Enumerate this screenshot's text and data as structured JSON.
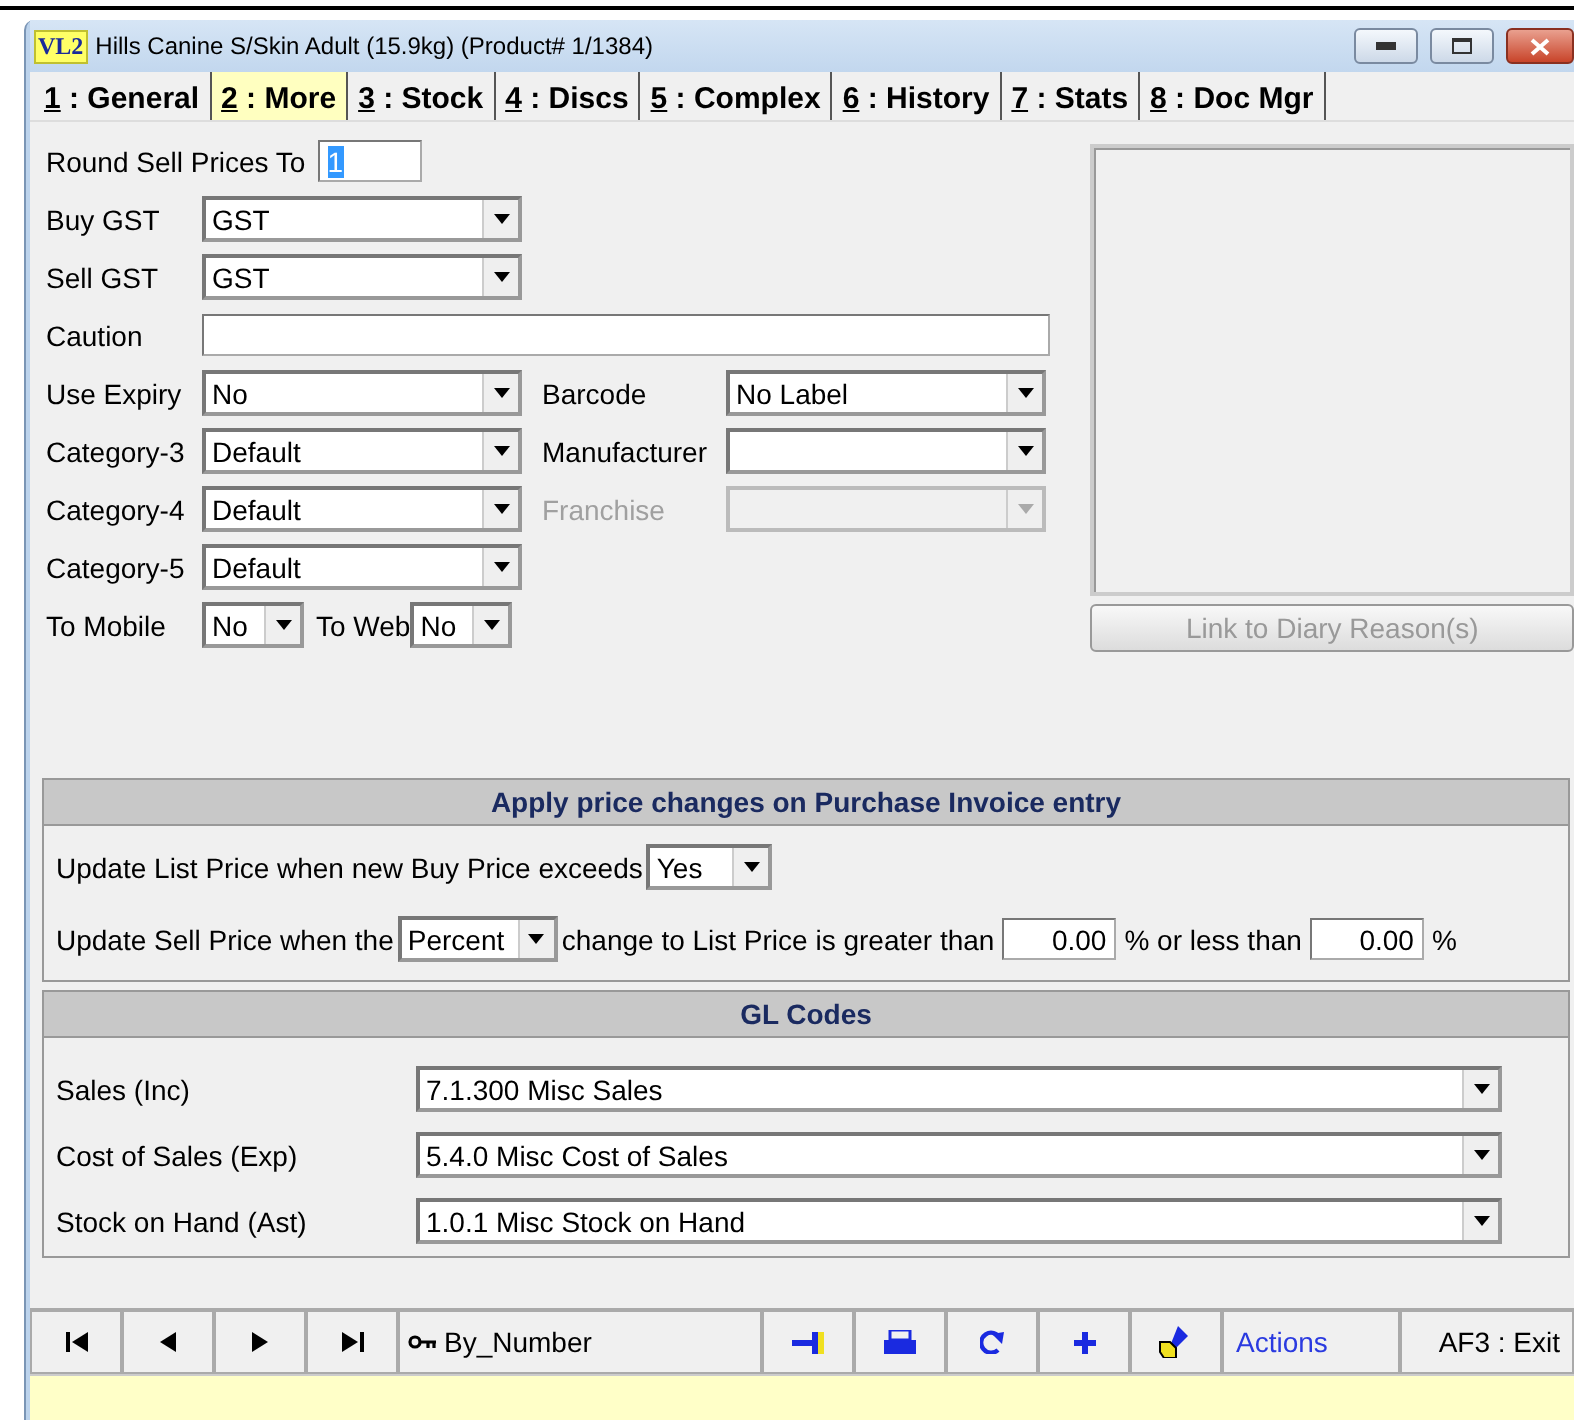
{
  "window": {
    "logo": "VL2",
    "title": "Hills Canine S/Skin Adult (15.9kg) (Product# 1/1384)"
  },
  "tabs": [
    {
      "key": "1",
      "label": " : General",
      "selected": false
    },
    {
      "key": "2",
      "label": " : More",
      "selected": true
    },
    {
      "key": "3",
      "label": " : Stock",
      "selected": false
    },
    {
      "key": "4",
      "label": " : Discs",
      "selected": false
    },
    {
      "key": "5",
      "label": " : Complex",
      "selected": false
    },
    {
      "key": "6",
      "label": " : History",
      "selected": false
    },
    {
      "key": "7",
      "label": " : Stats",
      "selected": false
    },
    {
      "key": "8",
      "label": " : Doc Mgr",
      "selected": false
    }
  ],
  "form_rows": [
    {
      "items": [
        {
          "kind": "input_short",
          "label": "Round Sell Prices To",
          "value": "1",
          "disabled": false
        }
      ]
    },
    {
      "items": [
        {
          "kind": "select",
          "label": "Buy GST",
          "value": "GST",
          "disabled": false
        }
      ]
    },
    {
      "items": [
        {
          "kind": "select",
          "label": "Sell GST",
          "value": "GST",
          "disabled": false
        }
      ]
    },
    {
      "items": [
        {
          "kind": "input_wide",
          "label": "Caution",
          "disabled": false
        }
      ]
    },
    {
      "items": [
        {
          "kind": "select",
          "label": "Use Expiry",
          "value": "No",
          "disabled": false
        },
        {
          "kind": "select",
          "label": "Barcode",
          "value": "No Label",
          "disabled": false
        }
      ]
    },
    {
      "items": [
        {
          "kind": "select",
          "label": "Category-3",
          "value": "Default",
          "disabled": false
        },
        {
          "kind": "select",
          "label": "Manufacturer",
          "disabled": false
        }
      ]
    },
    {
      "items": [
        {
          "kind": "select",
          "label": "Category-4",
          "value": "Default",
          "disabled": false
        },
        {
          "kind": "select",
          "label": "Franchise",
          "disabled": true
        }
      ]
    },
    {
      "items": [
        {
          "kind": "select",
          "label": "Category-5",
          "value": "Default",
          "disabled": false
        }
      ]
    },
    {
      "items": [
        {
          "kind": "select_short",
          "label": "To Mobile",
          "value": "No",
          "disabled": false
        },
        {
          "kind": "select_short",
          "label": "To Web",
          "value": "No",
          "disabled": false
        }
      ]
    }
  ],
  "diary_button": {
    "label": "Link to Diary Reason(s)",
    "disabled": true
  },
  "price_changes": {
    "title": "Apply price changes on Purchase Invoice entry",
    "list_price_rule": {
      "label": "Update List Price when new Buy Price exceeds",
      "value": "Yes"
    },
    "sell_price_rule": {
      "label_before": "Update Sell Price when the",
      "mode": "Percent",
      "label_middle": "change to List Price is greater than",
      "greater_than": "0.00",
      "label_less": "% or less than",
      "less_than": "0.00",
      "unit": "%"
    }
  },
  "gl_codes": {
    "title": "GL Codes",
    "rows": [
      {
        "label": "Sales  (Inc)",
        "value": "7.1.300 Misc Sales"
      },
      {
        "label": "Cost of Sales  (Exp)",
        "value": "5.4.0 Misc Cost of Sales"
      },
      {
        "label": "Stock on Hand  (Ast)",
        "value": "1.0.1 Misc Stock on Hand"
      }
    ]
  },
  "toolbar": [
    {
      "kind": "first"
    },
    {
      "kind": "prev"
    },
    {
      "kind": "next"
    },
    {
      "kind": "last"
    },
    {
      "kind": "sort",
      "label": "By_Number"
    },
    {
      "kind": "pin"
    },
    {
      "kind": "print"
    },
    {
      "kind": "refresh"
    },
    {
      "kind": "add"
    },
    {
      "kind": "edit"
    },
    {
      "kind": "actions",
      "label": "Actions"
    },
    {
      "kind": "exit",
      "label": "AF3 : Exit"
    }
  ]
}
